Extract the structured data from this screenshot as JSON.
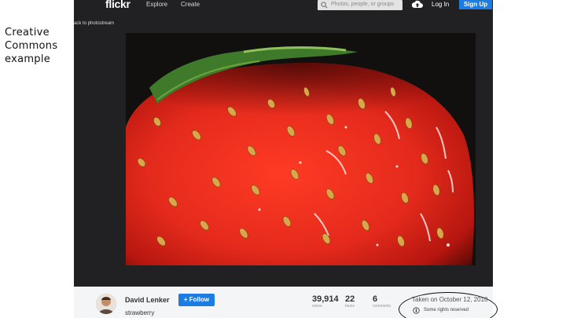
{
  "slide": {
    "caption": "Creative\nCommons\nexample"
  },
  "nav": {
    "logo": "flickr",
    "explore": "Explore",
    "create": "Create",
    "search_placeholder": "Photos, people, or groups",
    "login": "Log In",
    "signup": "Sign Up"
  },
  "photo": {
    "back_link": "ack to photostream"
  },
  "info": {
    "author": "David Lenker",
    "follow": "+ Follow",
    "title": "strawberry",
    "views_count": "39,914",
    "views_label": "views",
    "faves_count": "22",
    "faves_label": "faves",
    "comments_count": "6",
    "comments_label": "comments",
    "taken": "Taken on October 12, 2010",
    "rights": "Some rights reserved"
  },
  "colors": {
    "accent": "#1c7ce1",
    "nav_bg": "#212124",
    "photo_red": "#e42a1c"
  }
}
